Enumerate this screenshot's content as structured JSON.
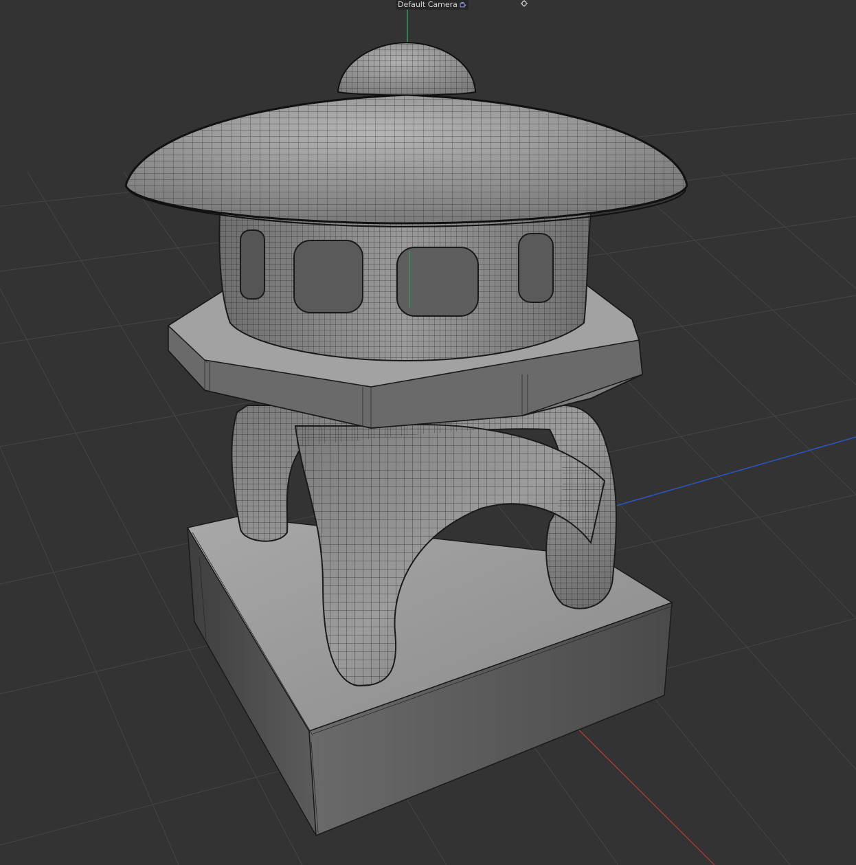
{
  "viewport": {
    "camera_name": "Default Camera",
    "camera_icon": "camera-lock-icon",
    "light_icon": "sun-gizmo-icon",
    "background_color": "#333333",
    "grid_color": "#444444",
    "axis_colors": {
      "x": "#c0393b",
      "y": "#2fa05a",
      "z": "#2c56c9"
    },
    "object_color": "#8f8f8f",
    "wire_color": "#1a1a1a"
  }
}
